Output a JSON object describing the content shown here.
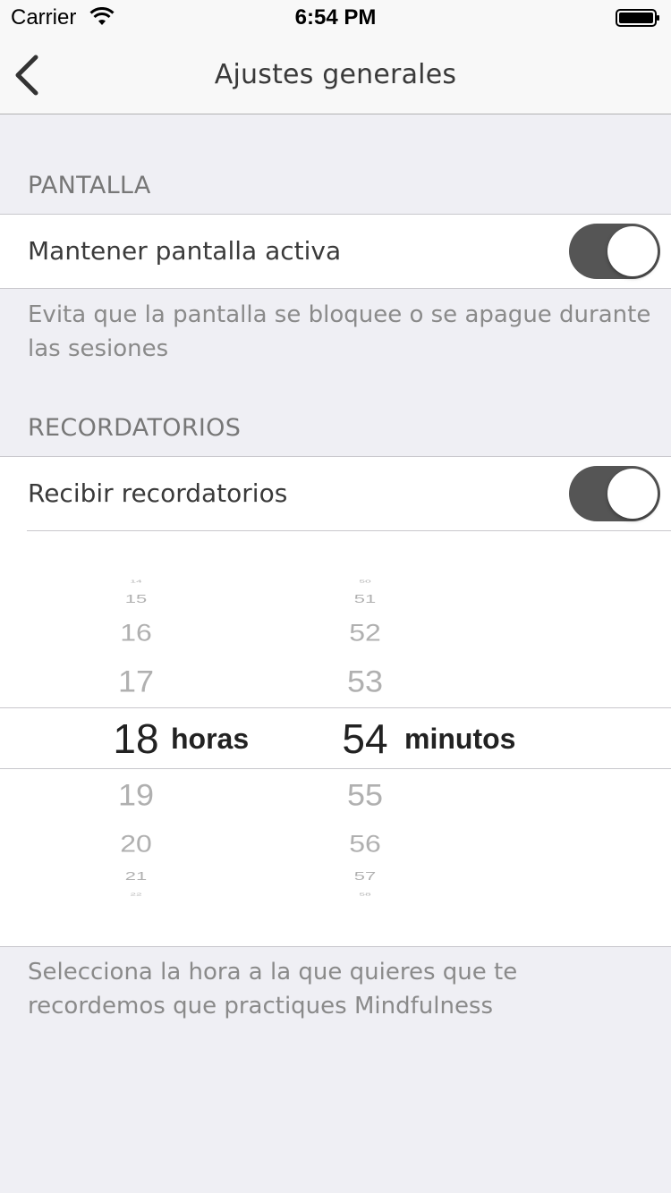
{
  "status_bar": {
    "carrier": "Carrier",
    "time": "6:54 PM"
  },
  "nav": {
    "title": "Ajustes generales"
  },
  "pantalla": {
    "header": "PANTALLA",
    "row_label": "Mantener pantalla activa",
    "toggle_on": true,
    "footer": "Evita que la pantalla se bloquee o se apague durante las sesiones"
  },
  "recordatorios": {
    "header": "RECORDATORIOS",
    "row_label": "Recibir recordatorios",
    "toggle_on": true,
    "footer": "Selecciona la hora a la que quieres que te recordemos que practiques Mindfulness"
  },
  "picker": {
    "hours": [
      "14",
      "15",
      "16",
      "17",
      "18",
      "19",
      "20",
      "21",
      "22"
    ],
    "minutes": [
      "50",
      "51",
      "52",
      "53",
      "54",
      "55",
      "56",
      "57",
      "58"
    ],
    "selected_hour": "18",
    "selected_minute": "54",
    "hour_unit": "horas",
    "minute_unit": "minutos"
  },
  "colors": {
    "toggle_on": "#555555",
    "background": "#efeff4"
  }
}
